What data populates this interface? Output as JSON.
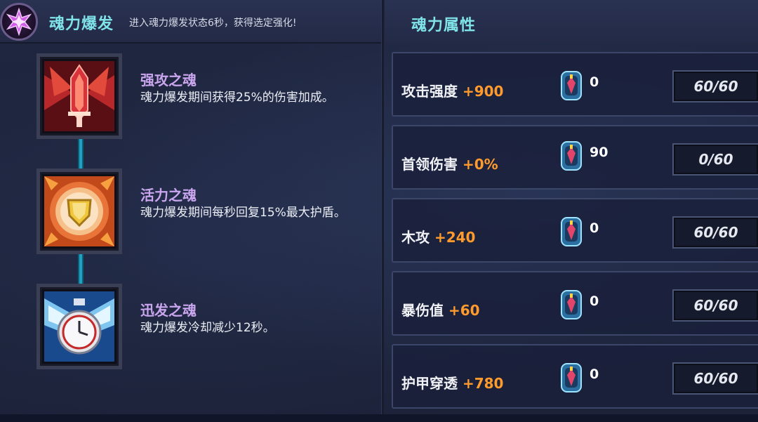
{
  "burst": {
    "title": "魂力爆发",
    "subtitle": "进入魂力爆发状态6秒，获得选定强化!"
  },
  "souls": [
    {
      "name": "强攻之魂",
      "desc": "魂力爆发期间获得25%的伤害加成。",
      "icon": "winged-sword-icon"
    },
    {
      "name": "活力之魂",
      "desc": "魂力爆发期间每秒回复15%最大护盾。",
      "icon": "golden-shield-icon"
    },
    {
      "name": "迅发之魂",
      "desc": "魂力爆发冷却减少12秒。",
      "icon": "winged-clock-icon"
    }
  ],
  "attributes": {
    "title": "魂力属性",
    "rows": [
      {
        "name": "攻击强度",
        "bonus": "+900",
        "gems": "0",
        "level": "60/60"
      },
      {
        "name": "首领伤害",
        "bonus": "+0%",
        "gems": "90",
        "level": "0/60"
      },
      {
        "name": "木攻",
        "bonus": "+240",
        "gems": "0",
        "level": "60/60"
      },
      {
        "name": "暴伤值",
        "bonus": "+60",
        "gems": "0",
        "level": "60/60"
      },
      {
        "name": "护甲穿透",
        "bonus": "+780",
        "gems": "0",
        "level": "60/60"
      }
    ]
  },
  "colors": {
    "header_text": "#7fe3e8",
    "soul_name": "#c9a6ee",
    "bonus": "#ff9a2c",
    "connector": "#1ca2c4"
  }
}
